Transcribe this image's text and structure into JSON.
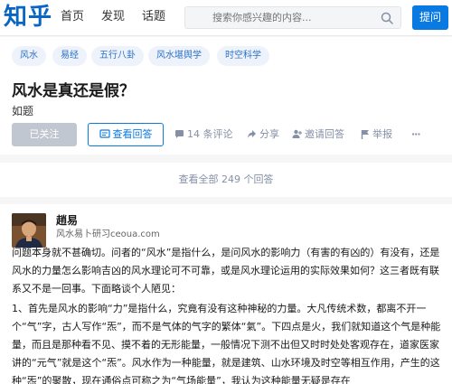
{
  "header": {
    "logo": "知乎",
    "nav": [
      "首页",
      "发现",
      "话题"
    ],
    "search_placeholder": "搜索你感兴趣的内容...",
    "ask_label": "提问"
  },
  "question": {
    "tags": [
      "风水",
      "易经",
      "五行八卦",
      "风水堪舆学",
      "时空科学"
    ],
    "title": "风水是真还是假？",
    "description": "如题",
    "followed_label": "已关注",
    "view_answers_label": "查看回答",
    "comments_label": "14 条评论",
    "share_label": "分享",
    "invite_label": "邀请回答",
    "report_label": "举报",
    "more_label": "···"
  },
  "view_all": {
    "label": "查看全部 249 个回答"
  },
  "answer": {
    "author_name": "趙易",
    "author_bio": "风水易卜研习ceoua.com",
    "paragraphs": [
      "问题本身就不甚确切。问者的“风水”是指什么，是问风水的影响力（有害的有凶的）有没有，还是风水的力量怎么影响吉凶的风水理论可不可靠，或是风水理论运用的实际效果如何？这三者既有联系又不是一回事。下面略谈个人陋见：",
      "1、首先是风水的影响“力”是指什么，究竟有没有这种神秘的力量。大凡传统术数，都离不开一个“气”字，古人写作“炁”，而不是气体的气字的繁体“氣”。下四点是火，我们就知道这个气是种能量，而且是那种看不见、摸不着的无形能量，一般情况下测不出但又时时处处客观存在，道家医家讲的“元气”就是这个“炁”。风水作为一种能量，就是建筑、山水环境及时空等相互作用，产生的这种“炁”的聚散，现在通俗点可称之为“气场能量”，我认为这种能量无疑是存在"
    ]
  },
  "colors": {
    "brand": "#0a66c2",
    "primary_button": "#0a7ae3",
    "tag_bg": "#eef3fb",
    "tag_text": "#2b71c6",
    "muted": "#8590a6"
  }
}
